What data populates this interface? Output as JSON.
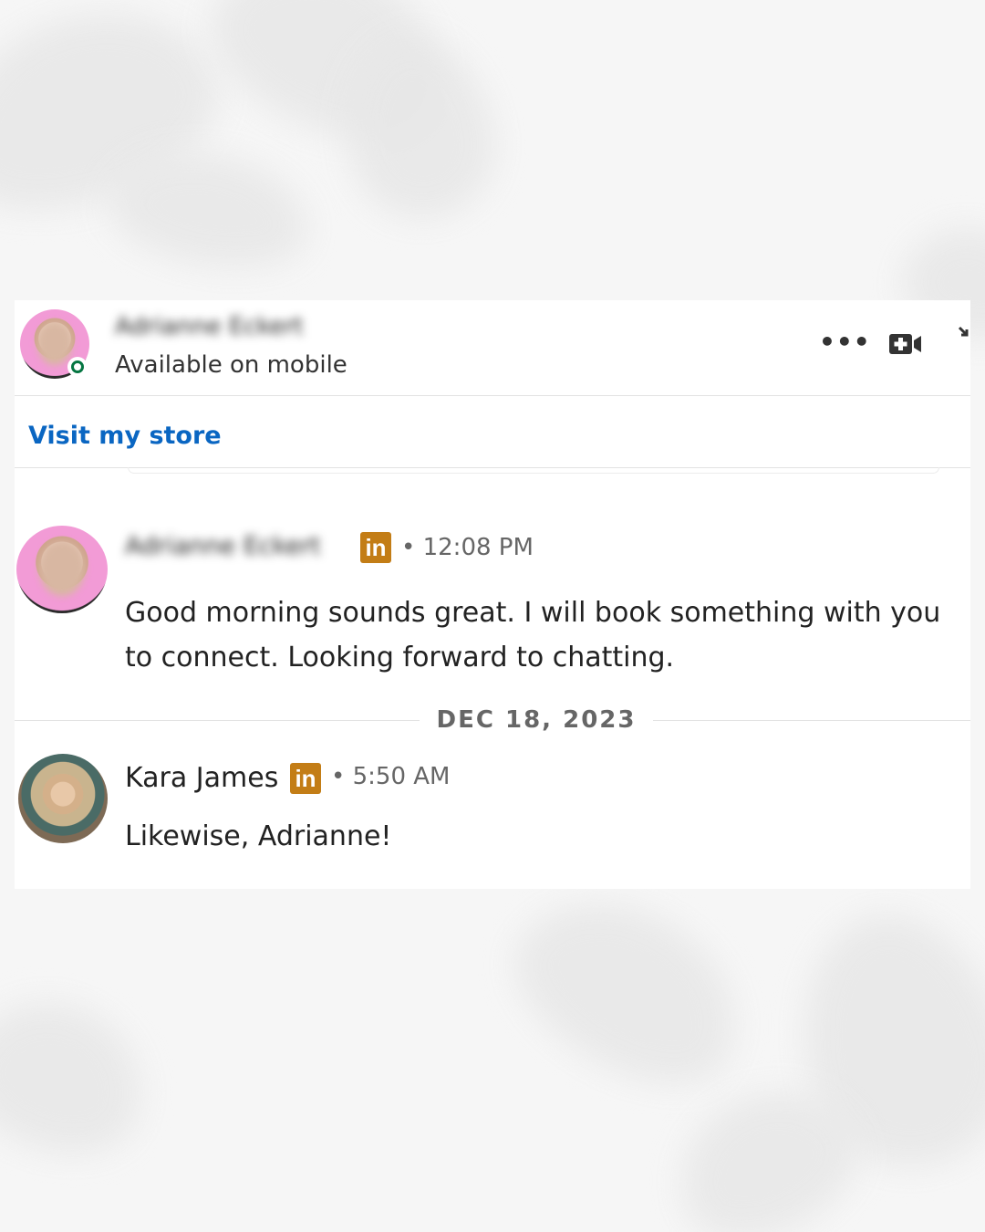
{
  "header": {
    "contact_name": "Adrianne Eckert",
    "status": "Available on mobile",
    "more_label": "•••"
  },
  "store": {
    "link_text": "Visit my store"
  },
  "messages": [
    {
      "sender": "Adrianne Eckert",
      "badge": "in",
      "time": "• 12:08 PM",
      "text": "Good morning sounds great. I will book something with you to connect. Looking forward to chatting."
    },
    {
      "sender": "Kara James",
      "badge": "in",
      "time": "• 5:50 AM",
      "text": "Likewise, Adrianne!"
    }
  ],
  "date_separator": "DEC 18, 2023",
  "colors": {
    "link": "#0a66c2",
    "online": "#057642",
    "linkedin_badge": "#c37d16"
  },
  "icons": [
    "more-icon",
    "video-call-icon",
    "collapse-icon",
    "linkedin-badge-icon"
  ]
}
